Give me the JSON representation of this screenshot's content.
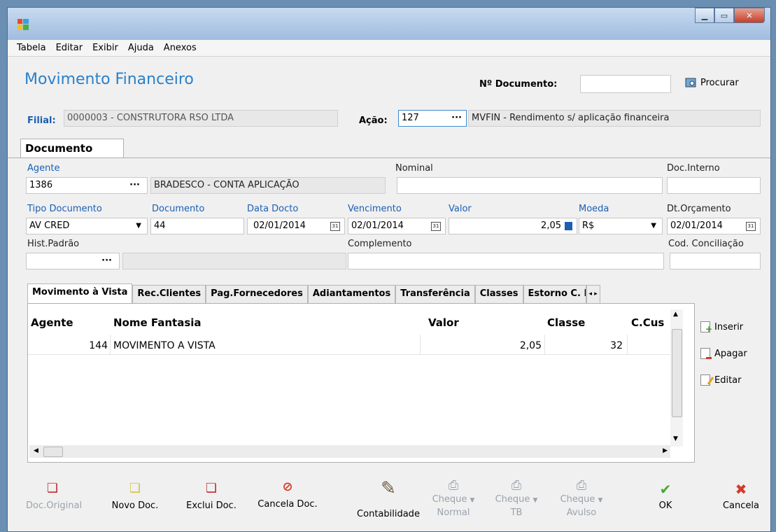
{
  "menu": [
    "Tabela",
    "Editar",
    "Exibir",
    "Ajuda",
    "Anexos"
  ],
  "header": {
    "title": "Movimento Financeiro",
    "doc_number_label": "Nº Documento:",
    "doc_number_value": "",
    "search_label": "Procurar",
    "filial_label": "Filial:",
    "filial_value": "0000003 - CONSTRUTORA RSO LTDA",
    "acao_label": "Ação:",
    "acao_code": "127",
    "acao_desc": "MVFIN - Rendimento s/ aplicação financeira"
  },
  "tab": "Documento",
  "form": {
    "agente_label": "Agente",
    "agente_code": "1386",
    "agente_name": "BRADESCO - CONTA APLICAÇÃO",
    "nominal_label": "Nominal",
    "nominal_value": "",
    "doc_interno_label": "Doc.Interno",
    "doc_interno_value": "",
    "tipo_doc_label": "Tipo Documento",
    "tipo_doc_value": "AV CRED",
    "documento_label": "Documento",
    "documento_value": "44",
    "data_docto_label": "Data Docto",
    "data_docto_value": "02/01/2014",
    "vencimento_label": "Vencimento",
    "vencimento_value": "02/01/2014",
    "valor_label": "Valor",
    "valor_value": "2,05",
    "moeda_label": "Moeda",
    "moeda_value": "R$",
    "dt_orcamento_label": "Dt.Orçamento",
    "dt_orcamento_value": "02/01/2014",
    "hist_label": "Hist.Padrão",
    "hist_value": "",
    "complemento_label": "Complemento",
    "complemento_value": "",
    "cod_conc_label": "Cod. Conciliação",
    "cod_conc_value": ""
  },
  "subtabs": [
    "Movimento à Vista",
    "Rec.Clientes",
    "Pag.Fornecedores",
    "Adiantamentos",
    "Transferência",
    "Classes",
    "Estorno C. Pag"
  ],
  "grid": {
    "headers": [
      "Agente",
      "Nome Fantasia",
      "Valor",
      "Classe",
      "C.Cus"
    ],
    "rows": [
      [
        "144",
        "MOVIMENTO A VISTA",
        "2,05",
        "32",
        ""
      ]
    ]
  },
  "side_buttons": [
    "Inserir",
    "Apagar",
    "Editar"
  ],
  "toolbar": {
    "doc_original": "Doc.Original",
    "novo_doc": "Novo Doc.",
    "exclui_doc": "Exclui Doc.",
    "cancela_doc": "Cancela Doc.",
    "contabilidade": "Contabilidade",
    "cheque_normal_1": "Cheque",
    "cheque_normal_2": "Normal",
    "cheque_tb_1": "Cheque",
    "cheque_tb_2": "TB",
    "cheque_avulso_1": "Cheque",
    "cheque_avulso_2": "Avulso",
    "ok": "OK",
    "cancela": "Cancela"
  },
  "colors": {
    "title_blue": "#2a80c8",
    "label_blue": "#1a5fb4",
    "ok_green": "#4aa832",
    "cancel_red": "#d23a2a"
  }
}
